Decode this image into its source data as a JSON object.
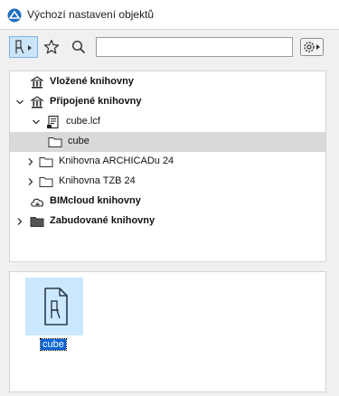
{
  "window": {
    "title": "Výchozí nastavení objektů"
  },
  "toolbar": {
    "search_placeholder": "",
    "search_value": ""
  },
  "tree": {
    "items": [
      {
        "label": "Vložené knihovny"
      },
      {
        "label": "Připojené knihovny"
      },
      {
        "label": "cube.lcf"
      },
      {
        "label": "cube"
      },
      {
        "label": "Knihovna ARCHICADu 24"
      },
      {
        "label": "Knihovna TZB 24"
      },
      {
        "label": "BIMcloud knihovny"
      },
      {
        "label": "Zabudované knihovny"
      }
    ]
  },
  "preview": {
    "items": [
      {
        "label": "cube"
      }
    ]
  },
  "colors": {
    "selection": "#d9d9d9",
    "accent": "#0a64d6",
    "tile": "#cce8ff"
  }
}
